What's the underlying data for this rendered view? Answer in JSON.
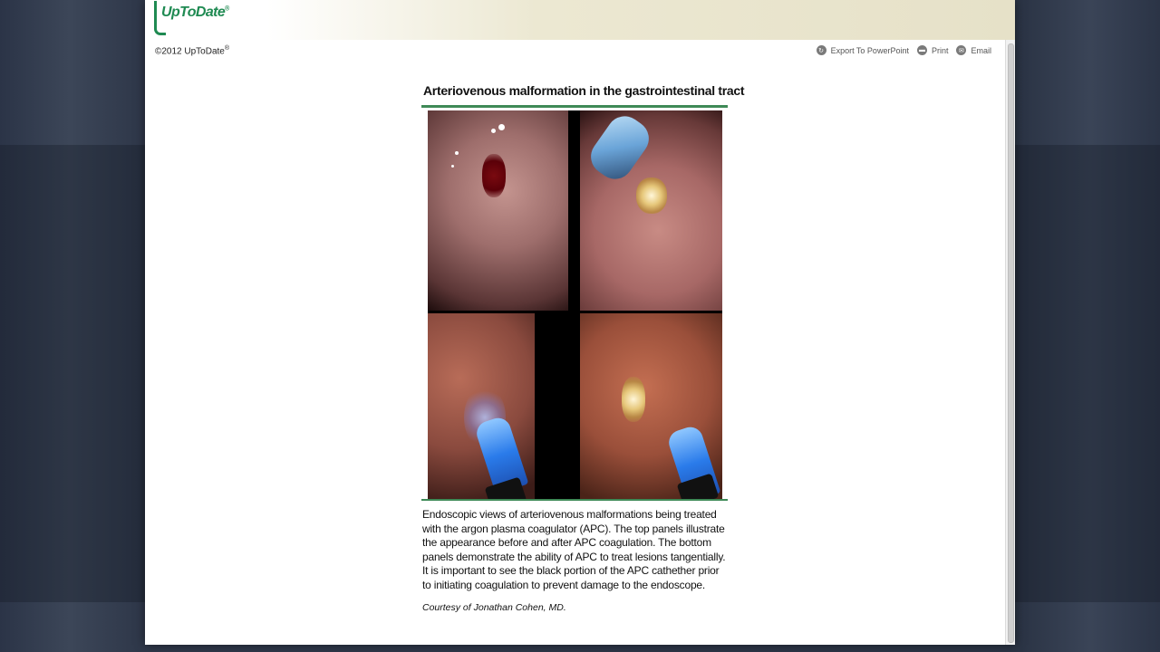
{
  "app": {
    "logo_text": "UpToDate",
    "logo_mark": "®",
    "copyright_text": "©2012 UpToDate",
    "copyright_mark": "®"
  },
  "toolbar": {
    "actions": [
      {
        "label": "Export To PowerPoint",
        "icon": "export-icon"
      },
      {
        "label": "Print",
        "icon": "print-icon"
      },
      {
        "label": "Email",
        "icon": "email-icon"
      }
    ]
  },
  "figure": {
    "title": "Arteriovenous malformation in the gastrointestinal tract",
    "caption": "Endoscopic views of arteriovenous malformations being treated with the argon plasma coagulator (APC). The top panels illustrate the appearance before and after APC coagulation. The bottom panels demonstrate the ability of APC to treat lesions tangentially. It is important to see the black portion of the APC cathether prior to initiating coagulation to prevent damage to the endoscope.",
    "credit": "Courtesy of Jonathan Cohen, MD."
  },
  "colors": {
    "brand_green": "#1f8a52",
    "rule_green": "#3f8a57",
    "background": "#2b3447"
  }
}
